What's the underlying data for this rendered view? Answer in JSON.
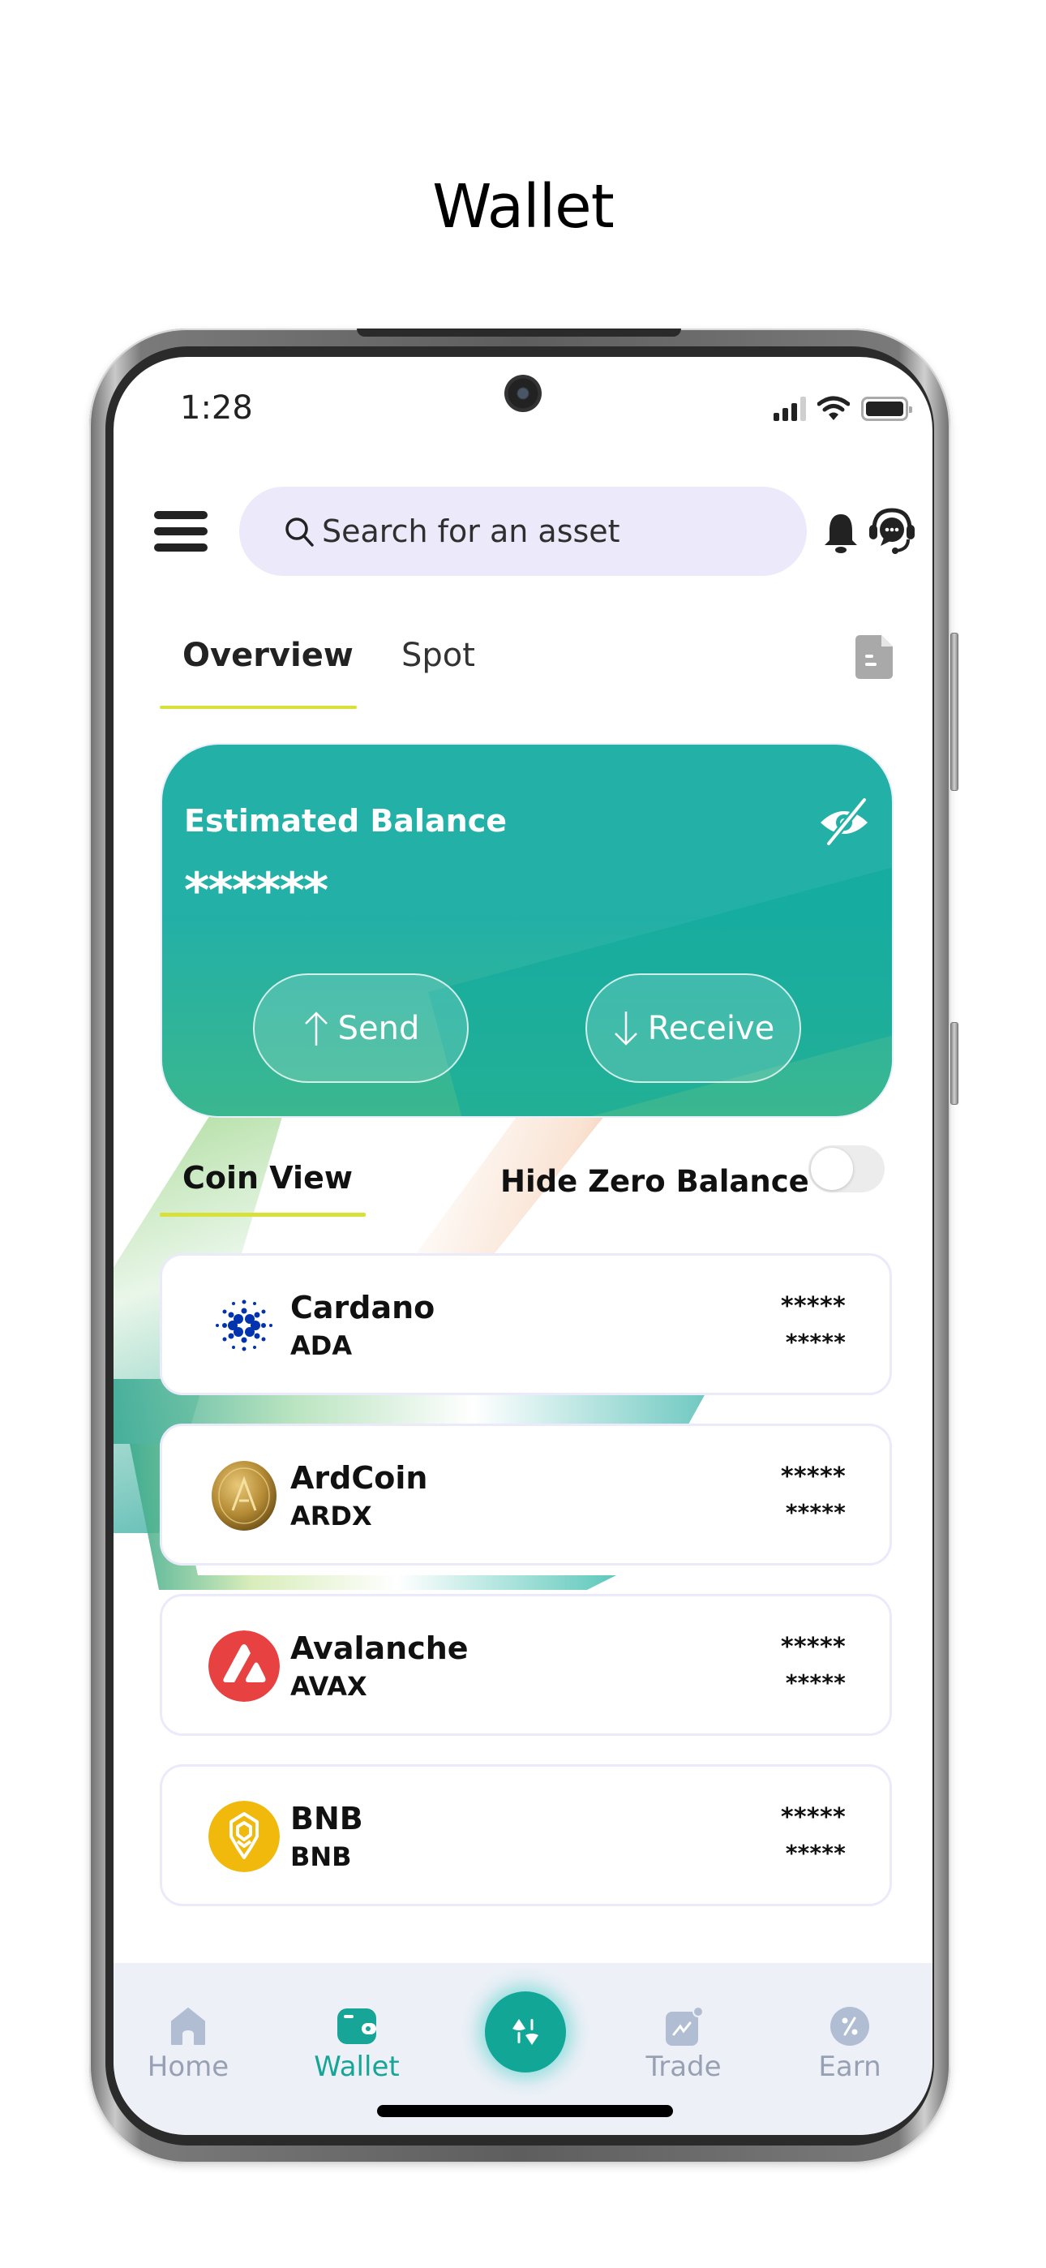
{
  "page_title": "Wallet",
  "status_bar": {
    "time": "1:28",
    "icons": [
      "signal-icon",
      "wifi-icon",
      "battery-icon"
    ]
  },
  "header": {
    "menu_icon": "hamburger-icon",
    "search": {
      "placeholder": "Search for an asset",
      "value": ""
    },
    "notification_icon": "bell-icon",
    "support_icon": "support-chat-icon"
  },
  "tabs": {
    "items": [
      {
        "label": "Overview",
        "active": true
      },
      {
        "label": "Spot",
        "active": false
      }
    ],
    "report_icon": "document-icon"
  },
  "balance_card": {
    "label": "Estimated Balance",
    "value": "******",
    "visibility_icon": "eye-off-icon",
    "send_label": "Send",
    "receive_label": "Receive"
  },
  "coin_section": {
    "view_label": "Coin View",
    "hide_zero_label": "Hide Zero Balance",
    "hide_zero_enabled": false
  },
  "coins": [
    {
      "name": "Cardano",
      "symbol": "ADA",
      "amount": "*****",
      "value": "*****",
      "logo": "cardano-logo",
      "color": "#0033ad"
    },
    {
      "name": "ArdCoin",
      "symbol": "ARDX",
      "amount": "*****",
      "value": "*****",
      "logo": "ardcoin-logo",
      "color": "#b8903a"
    },
    {
      "name": "Avalanche",
      "symbol": "AVAX",
      "amount": "*****",
      "value": "*****",
      "logo": "avalanche-logo",
      "color": "#e84142"
    },
    {
      "name": "BNB",
      "symbol": "BNB",
      "amount": "*****",
      "value": "*****",
      "logo": "bnb-logo",
      "color": "#f0b90b"
    }
  ],
  "bottom_nav": {
    "items": [
      {
        "label": "Home",
        "icon": "home-icon",
        "active": false
      },
      {
        "label": "Wallet",
        "icon": "wallet-icon",
        "active": true
      },
      {
        "label": "Trade",
        "icon": "trade-chart-icon",
        "active": false
      },
      {
        "label": "Earn",
        "icon": "percent-icon",
        "active": false
      }
    ],
    "center_action_icon": "swap-arrows-icon"
  },
  "colors": {
    "accent": "#12a697",
    "card_teal": "#22b0a7",
    "tab_underline": "#d7e13a",
    "search_bg": "#eceafa",
    "nav_bg": "#edf0f7",
    "nav_inactive": "#98a1b3"
  }
}
